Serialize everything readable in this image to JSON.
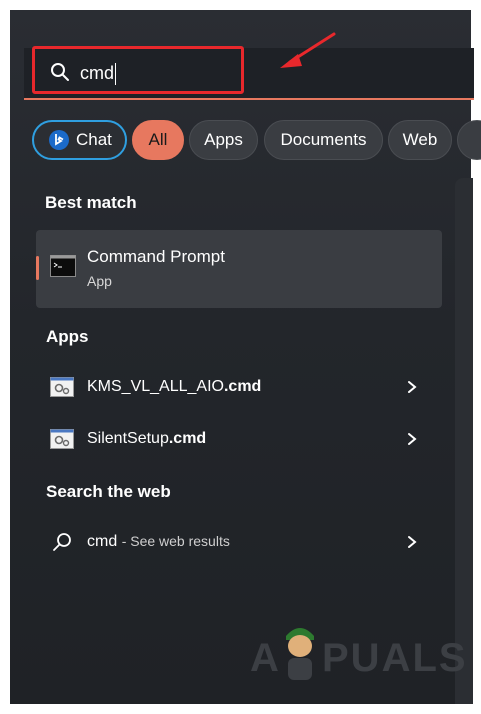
{
  "search": {
    "query": "cmd",
    "icon": "search-icon"
  },
  "annotation": {
    "color": "#e8282c"
  },
  "chips": [
    {
      "label": "Chat",
      "icon": "bing-chat-icon",
      "active": false
    },
    {
      "label": "All",
      "active": true
    },
    {
      "label": "Apps",
      "active": false
    },
    {
      "label": "Documents",
      "active": false
    },
    {
      "label": "Web",
      "active": false
    }
  ],
  "best_match": {
    "heading": "Best match",
    "name": "Command Prompt",
    "type": "App",
    "icon": "command-prompt-icon"
  },
  "apps": {
    "heading": "Apps",
    "items": [
      {
        "name_prefix": "KMS_VL_ALL_AIO",
        "name_ext": ".cmd",
        "icon": "batch-file-icon"
      },
      {
        "name_prefix": "SilentSetup",
        "name_ext": ".cmd",
        "icon": "batch-file-icon"
      }
    ]
  },
  "web": {
    "heading": "Search the web",
    "query": "cmd",
    "suffix": "- See web results",
    "icon": "search-icon"
  },
  "watermark": {
    "left": "A",
    "right": "PUALS"
  },
  "colors": {
    "accent": "#e7785f",
    "chat_border": "#2f9fe0",
    "panel": "#23262b"
  }
}
